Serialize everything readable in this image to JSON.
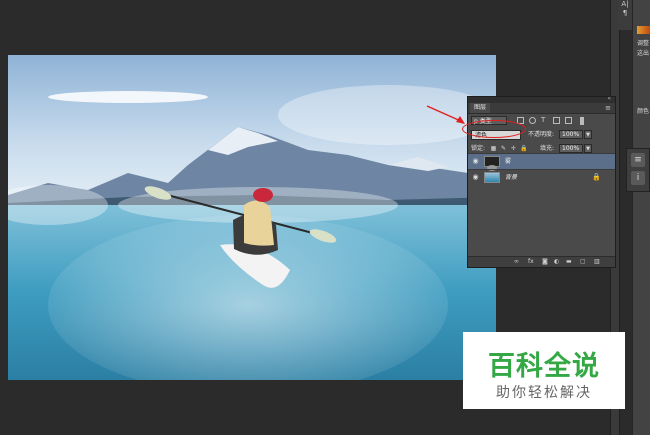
{
  "layers_panel": {
    "tab_label": "图层",
    "kind_filter": "p 类型",
    "blend_mode": "滤色",
    "opacity_label": "不透明度:",
    "opacity_value": "100%",
    "lock_label": "锁定:",
    "fill_label": "填充:",
    "fill_value": "100%",
    "layers": [
      {
        "name": "雾",
        "selected": true
      },
      {
        "name": "背景",
        "selected": false,
        "locked": true
      }
    ],
    "footer_icons": [
      "link-icon",
      "fx-icon",
      "mask-icon",
      "adjustment-icon",
      "group-icon",
      "new-layer-icon",
      "trash-icon"
    ]
  },
  "right_panel": {
    "top_labels": [
      "A|",
      "¶"
    ],
    "side_labels": [
      "调整",
      "这出",
      "颜色"
    ]
  },
  "watermark": {
    "logo": "百科全说",
    "tagline": "助你轻松解决"
  },
  "colors": {
    "app_bg": "#2b2b2b",
    "panel_bg": "#4a4a4a",
    "selected_layer": "#5c6f8a",
    "annotation_red": "#e02020",
    "watermark_green": "#33a845"
  }
}
